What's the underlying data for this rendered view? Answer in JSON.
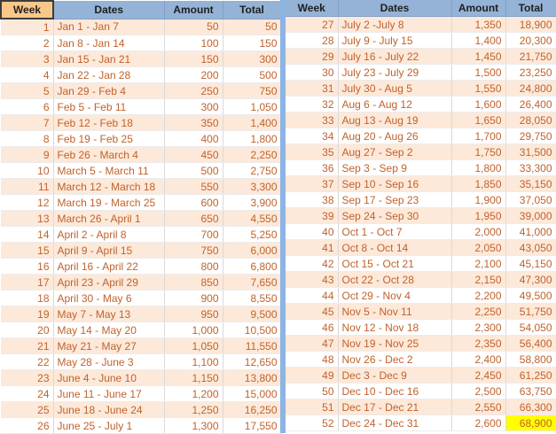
{
  "columns": {
    "week": "Week",
    "dates": "Dates",
    "amount": "Amount",
    "total": "Total"
  },
  "highlight_color": "#ffff00",
  "left_rows": [
    {
      "week": "1",
      "dates": "Jan 1 - Jan 7",
      "amount": "50",
      "total": "50"
    },
    {
      "week": "2",
      "dates": "Jan 8 - Jan 14",
      "amount": "100",
      "total": "150"
    },
    {
      "week": "3",
      "dates": "Jan 15 - Jan 21",
      "amount": "150",
      "total": "300"
    },
    {
      "week": "4",
      "dates": "Jan 22 - Jan 28",
      "amount": "200",
      "total": "500"
    },
    {
      "week": "5",
      "dates": "Jan 29 - Feb 4",
      "amount": "250",
      "total": "750"
    },
    {
      "week": "6",
      "dates": "Feb 5 - Feb 11",
      "amount": "300",
      "total": "1,050"
    },
    {
      "week": "7",
      "dates": "Feb 12 - Feb 18",
      "amount": "350",
      "total": "1,400"
    },
    {
      "week": "8",
      "dates": "Feb 19 - Feb 25",
      "amount": "400",
      "total": "1,800"
    },
    {
      "week": "9",
      "dates": "Feb 26 - March 4",
      "amount": "450",
      "total": "2,250"
    },
    {
      "week": "10",
      "dates": "March 5 - March 11",
      "amount": "500",
      "total": "2,750"
    },
    {
      "week": "11",
      "dates": "March 12 - March 18",
      "amount": "550",
      "total": "3,300"
    },
    {
      "week": "12",
      "dates": "March 19 - March 25",
      "amount": "600",
      "total": "3,900"
    },
    {
      "week": "13",
      "dates": "March 26 - April 1",
      "amount": "650",
      "total": "4,550"
    },
    {
      "week": "14",
      "dates": "April 2 - April 8",
      "amount": "700",
      "total": "5,250"
    },
    {
      "week": "15",
      "dates": "April 9 - April 15",
      "amount": "750",
      "total": "6,000"
    },
    {
      "week": "16",
      "dates": "April 16 - April 22",
      "amount": "800",
      "total": "6,800"
    },
    {
      "week": "17",
      "dates": "April 23 - April 29",
      "amount": "850",
      "total": "7,650"
    },
    {
      "week": "18",
      "dates": "April 30 - May 6",
      "amount": "900",
      "total": "8,550"
    },
    {
      "week": "19",
      "dates": "May 7 - May 13",
      "amount": "950",
      "total": "9,500"
    },
    {
      "week": "20",
      "dates": "May 14 - May 20",
      "amount": "1,000",
      "total": "10,500"
    },
    {
      "week": "21",
      "dates": "May 21 - May 27",
      "amount": "1,050",
      "total": "11,550"
    },
    {
      "week": "22",
      "dates": "May 28 - June 3",
      "amount": "1,100",
      "total": "12,650"
    },
    {
      "week": "23",
      "dates": "June 4 - June 10",
      "amount": "1,150",
      "total": "13,800"
    },
    {
      "week": "24",
      "dates": "June 11 - June 17",
      "amount": "1,200",
      "total": "15,000"
    },
    {
      "week": "25",
      "dates": "June 18 - June 24",
      "amount": "1,250",
      "total": "16,250"
    },
    {
      "week": "26",
      "dates": "June 25 - July 1",
      "amount": "1,300",
      "total": "17,550"
    }
  ],
  "right_rows": [
    {
      "week": "27",
      "dates": "July 2 -July 8",
      "amount": "1,350",
      "total": "18,900"
    },
    {
      "week": "28",
      "dates": "July 9 - July 15",
      "amount": "1,400",
      "total": "20,300"
    },
    {
      "week": "29",
      "dates": "July 16 - July 22",
      "amount": "1,450",
      "total": "21,750"
    },
    {
      "week": "30",
      "dates": "July 23 - July 29",
      "amount": "1,500",
      "total": "23,250"
    },
    {
      "week": "31",
      "dates": "July 30 - Aug 5",
      "amount": "1,550",
      "total": "24,800"
    },
    {
      "week": "32",
      "dates": "Aug 6 - Aug 12",
      "amount": "1,600",
      "total": "26,400"
    },
    {
      "week": "33",
      "dates": "Aug 13 - Aug 19",
      "amount": "1,650",
      "total": "28,050"
    },
    {
      "week": "34",
      "dates": "Aug 20 - Aug 26",
      "amount": "1,700",
      "total": "29,750"
    },
    {
      "week": "35",
      "dates": "Aug 27 - Sep 2",
      "amount": "1,750",
      "total": "31,500"
    },
    {
      "week": "36",
      "dates": "Sep 3 - Sep 9",
      "amount": "1,800",
      "total": "33,300"
    },
    {
      "week": "37",
      "dates": "Sep 10 - Sep 16",
      "amount": "1,850",
      "total": "35,150"
    },
    {
      "week": "38",
      "dates": "Sep 17 - Sep 23",
      "amount": "1,900",
      "total": "37,050"
    },
    {
      "week": "39",
      "dates": "Sep 24 - Sep 30",
      "amount": "1,950",
      "total": "39,000"
    },
    {
      "week": "40",
      "dates": "Oct 1 - Oct 7",
      "amount": "2,000",
      "total": "41,000"
    },
    {
      "week": "41",
      "dates": "Oct 8 - Oct 14",
      "amount": "2,050",
      "total": "43,050"
    },
    {
      "week": "42",
      "dates": "Oct 15 - Oct 21",
      "amount": "2,100",
      "total": "45,150"
    },
    {
      "week": "43",
      "dates": "Oct 22 - Oct 28",
      "amount": "2,150",
      "total": "47,300"
    },
    {
      "week": "44",
      "dates": "Oct 29 - Nov 4",
      "amount": "2,200",
      "total": "49,500"
    },
    {
      "week": "45",
      "dates": "Nov 5 - Nov 11",
      "amount": "2,250",
      "total": "51,750"
    },
    {
      "week": "46",
      "dates": "Nov 12 - Nov 18",
      "amount": "2,300",
      "total": "54,050"
    },
    {
      "week": "47",
      "dates": "Nov 19 - Nov 25",
      "amount": "2,350",
      "total": "56,400"
    },
    {
      "week": "48",
      "dates": "Nov 26 - Dec 2",
      "amount": "2,400",
      "total": "58,800"
    },
    {
      "week": "49",
      "dates": "Dec 3 - Dec 9",
      "amount": "2,450",
      "total": "61,250"
    },
    {
      "week": "50",
      "dates": "Dec 10 - Dec 16",
      "amount": "2,500",
      "total": "63,750"
    },
    {
      "week": "51",
      "dates": "Dec 17 - Dec 21",
      "amount": "2,550",
      "total": "66,300"
    },
    {
      "week": "52",
      "dates": "Dec 24 - Dec 31",
      "amount": "2,600",
      "total": "68,900"
    }
  ]
}
